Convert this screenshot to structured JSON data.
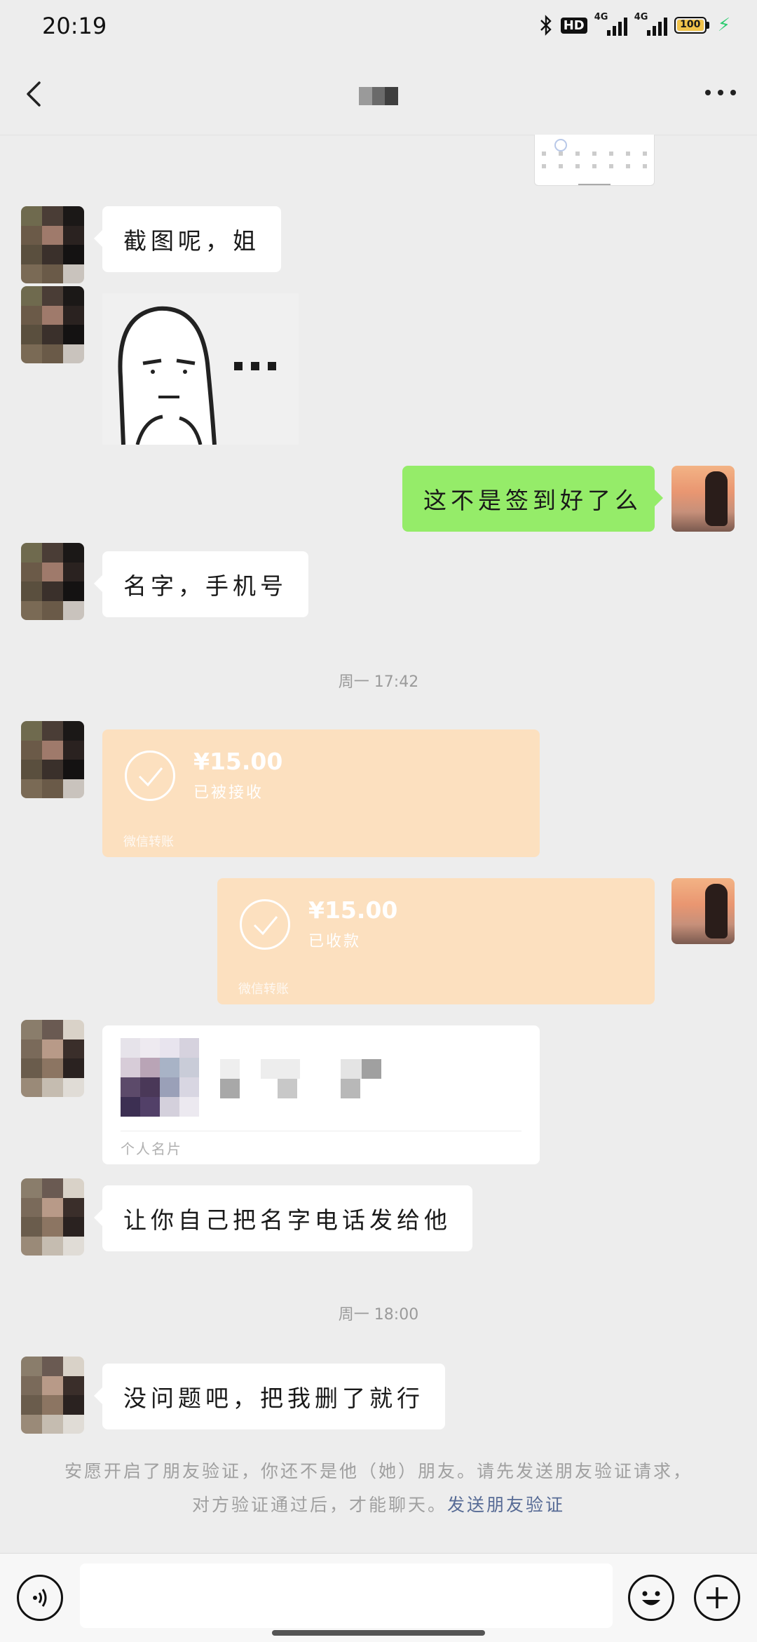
{
  "status_bar": {
    "time": "20:19",
    "icons": [
      "bluetooth-icon",
      "hd-icon",
      "signal-4g-icon",
      "signal-4g-icon",
      "battery-icon",
      "charging-icon"
    ],
    "hd_label": "HD",
    "sig1_label": "4G",
    "sig2_label": "4G",
    "battery_text": "100",
    "battery_level": 1.0
  },
  "header": {
    "back_icon": "chevron-left-icon",
    "more_icon": "more-dots-icon"
  },
  "messages": {
    "m1": "截图呢，姐",
    "m3": "这不是签到好了么",
    "m4": "名字，手机号",
    "ts1": "周一 17:42",
    "t1": {
      "amount": "¥15.00",
      "status": "已被接收",
      "source": "微信转账"
    },
    "t2": {
      "amount": "¥15.00",
      "status": "已收款",
      "source": "微信转账"
    },
    "card_footer": "个人名片",
    "m7": "让你自己把名字电话发给他",
    "ts2": "周一 18:00",
    "m8": "没问题吧，把我删了就行"
  },
  "notice": {
    "text": "安愿开启了朋友验证，你还不是他（她）朋友。请先发送朋友验证请求，对方验证通过后，才能聊天。",
    "link": "发送朋友验证"
  },
  "input_bar": {
    "icons": [
      "voice-icon",
      "emoji-icon",
      "plus-icon"
    ]
  },
  "colors": {
    "background": "#ededed",
    "outgoing_bubble": "#95ec69",
    "incoming_bubble": "#ffffff",
    "transfer_card": "#fce0bf",
    "link": "#576b95"
  }
}
